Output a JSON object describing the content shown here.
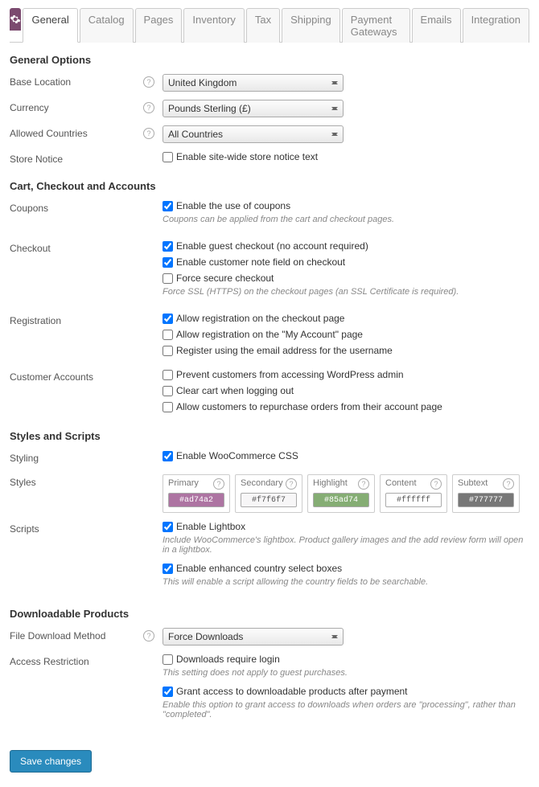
{
  "tabs": {
    "items": [
      "General",
      "Catalog",
      "Pages",
      "Inventory",
      "Tax",
      "Shipping",
      "Payment Gateways",
      "Emails",
      "Integration"
    ],
    "active": 0
  },
  "sections": {
    "general": {
      "heading": "General Options",
      "base_location": {
        "label": "Base Location",
        "value": "United Kingdom"
      },
      "currency": {
        "label": "Currency",
        "value": "Pounds Sterling (£)"
      },
      "allowed_countries": {
        "label": "Allowed Countries",
        "value": "All Countries"
      },
      "store_notice": {
        "label": "Store Notice",
        "checkbox": "Enable site-wide store notice text",
        "checked": false
      }
    },
    "cart": {
      "heading": "Cart, Checkout and Accounts",
      "coupons": {
        "label": "Coupons",
        "checkbox": "Enable the use of coupons",
        "checked": true,
        "desc": "Coupons can be applied from the cart and checkout pages."
      },
      "checkout": {
        "label": "Checkout",
        "guest": {
          "label": "Enable guest checkout (no account required)",
          "checked": true
        },
        "note": {
          "label": "Enable customer note field on checkout",
          "checked": true
        },
        "secure": {
          "label": "Force secure checkout",
          "checked": false
        },
        "desc": "Force SSL (HTTPS) on the checkout pages (an SSL Certificate is required)."
      },
      "registration": {
        "label": "Registration",
        "checkout_page": {
          "label": "Allow registration on the checkout page",
          "checked": true
        },
        "account_page": {
          "label": "Allow registration on the \"My Account\" page",
          "checked": false
        },
        "email_username": {
          "label": "Register using the email address for the username",
          "checked": false
        }
      },
      "accounts": {
        "label": "Customer Accounts",
        "prevent_admin": {
          "label": "Prevent customers from accessing WordPress admin",
          "checked": false
        },
        "clear_cart": {
          "label": "Clear cart when logging out",
          "checked": false
        },
        "repurchase": {
          "label": "Allow customers to repurchase orders from their account page",
          "checked": false
        }
      }
    },
    "styles": {
      "heading": "Styles and Scripts",
      "styling": {
        "label": "Styling",
        "checkbox": "Enable WooCommerce CSS",
        "checked": true
      },
      "styles_row": {
        "label": "Styles",
        "primary": {
          "name": "Primary",
          "value": "#ad74a2",
          "bg": "#ad74a2",
          "light": false
        },
        "secondary": {
          "name": "Secondary",
          "value": "#f7f6f7",
          "bg": "#f7f6f7",
          "light": true
        },
        "highlight": {
          "name": "Highlight",
          "value": "#85ad74",
          "bg": "#85ad74",
          "light": false
        },
        "content": {
          "name": "Content",
          "value": "#ffffff",
          "bg": "#ffffff",
          "light": true
        },
        "subtext": {
          "name": "Subtext",
          "value": "#777777",
          "bg": "#777777",
          "light": false
        }
      },
      "scripts": {
        "label": "Scripts",
        "lightbox": {
          "label": "Enable Lightbox",
          "checked": true
        },
        "lightbox_desc": "Include WooCommerce's lightbox. Product gallery images and the add review form will open in a lightbox.",
        "country_select": {
          "label": "Enable enhanced country select boxes",
          "checked": true
        },
        "country_desc": "This will enable a script allowing the country fields to be searchable."
      }
    },
    "downloads": {
      "heading": "Downloadable Products",
      "method": {
        "label": "File Download Method",
        "value": "Force Downloads"
      },
      "access": {
        "label": "Access Restriction",
        "require_login": {
          "label": "Downloads require login",
          "checked": false
        },
        "require_desc": "This setting does not apply to guest purchases.",
        "grant_after_payment": {
          "label": "Grant access to downloadable products after payment",
          "checked": true
        },
        "grant_desc": "Enable this option to grant access to downloads when orders are \"processing\", rather than \"completed\"."
      }
    }
  },
  "save_label": "Save changes"
}
